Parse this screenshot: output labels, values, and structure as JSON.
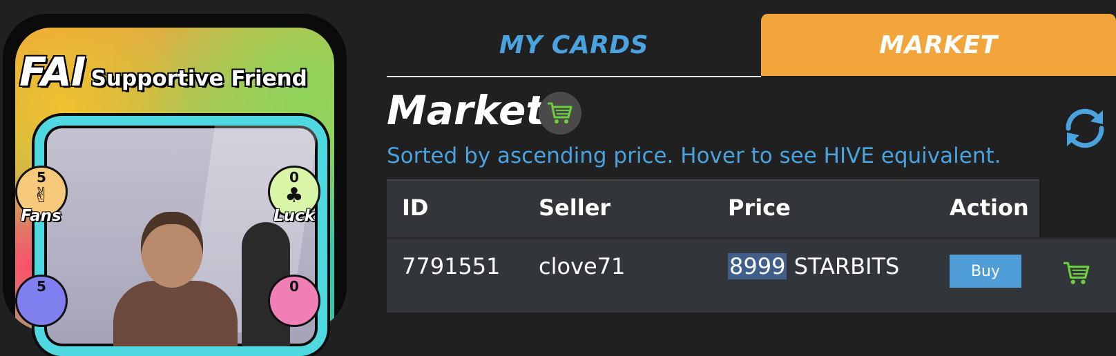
{
  "card": {
    "title_big": "FAI",
    "title_small": "Supportive Friend",
    "stats": [
      {
        "value": "5",
        "label": "Fans",
        "glyph": "✌",
        "color": "#f7c97a",
        "icon": "crowd-icon"
      },
      {
        "value": "0",
        "label": "Luck",
        "glyph": "♣",
        "color": "#d8f5a8",
        "icon": "clover-icon"
      },
      {
        "value": "5",
        "label": "",
        "glyph": "",
        "color": "#7f7ff0",
        "icon": "stat-icon"
      },
      {
        "value": "0",
        "label": "",
        "glyph": "",
        "color": "#f07fb5",
        "icon": "stat-icon"
      }
    ]
  },
  "tabs": {
    "my_cards": "MY CARDS",
    "market": "MARKET",
    "active": "market"
  },
  "market": {
    "title": "Market",
    "subtitle": "Sorted by ascending price. Hover to see HIVE equivalent.",
    "columns": [
      "ID",
      "Seller",
      "Price",
      "Action"
    ],
    "rows": [
      {
        "id": "7791551",
        "seller": "clove71",
        "price": "8999",
        "currency": "STARBITS",
        "action": "Buy"
      }
    ]
  },
  "colors": {
    "accent_blue": "#4aa3df",
    "tab_orange": "#f2a53a",
    "cart_green": "#6ccf3c",
    "background": "#202020",
    "table_bg": "#32363a"
  }
}
